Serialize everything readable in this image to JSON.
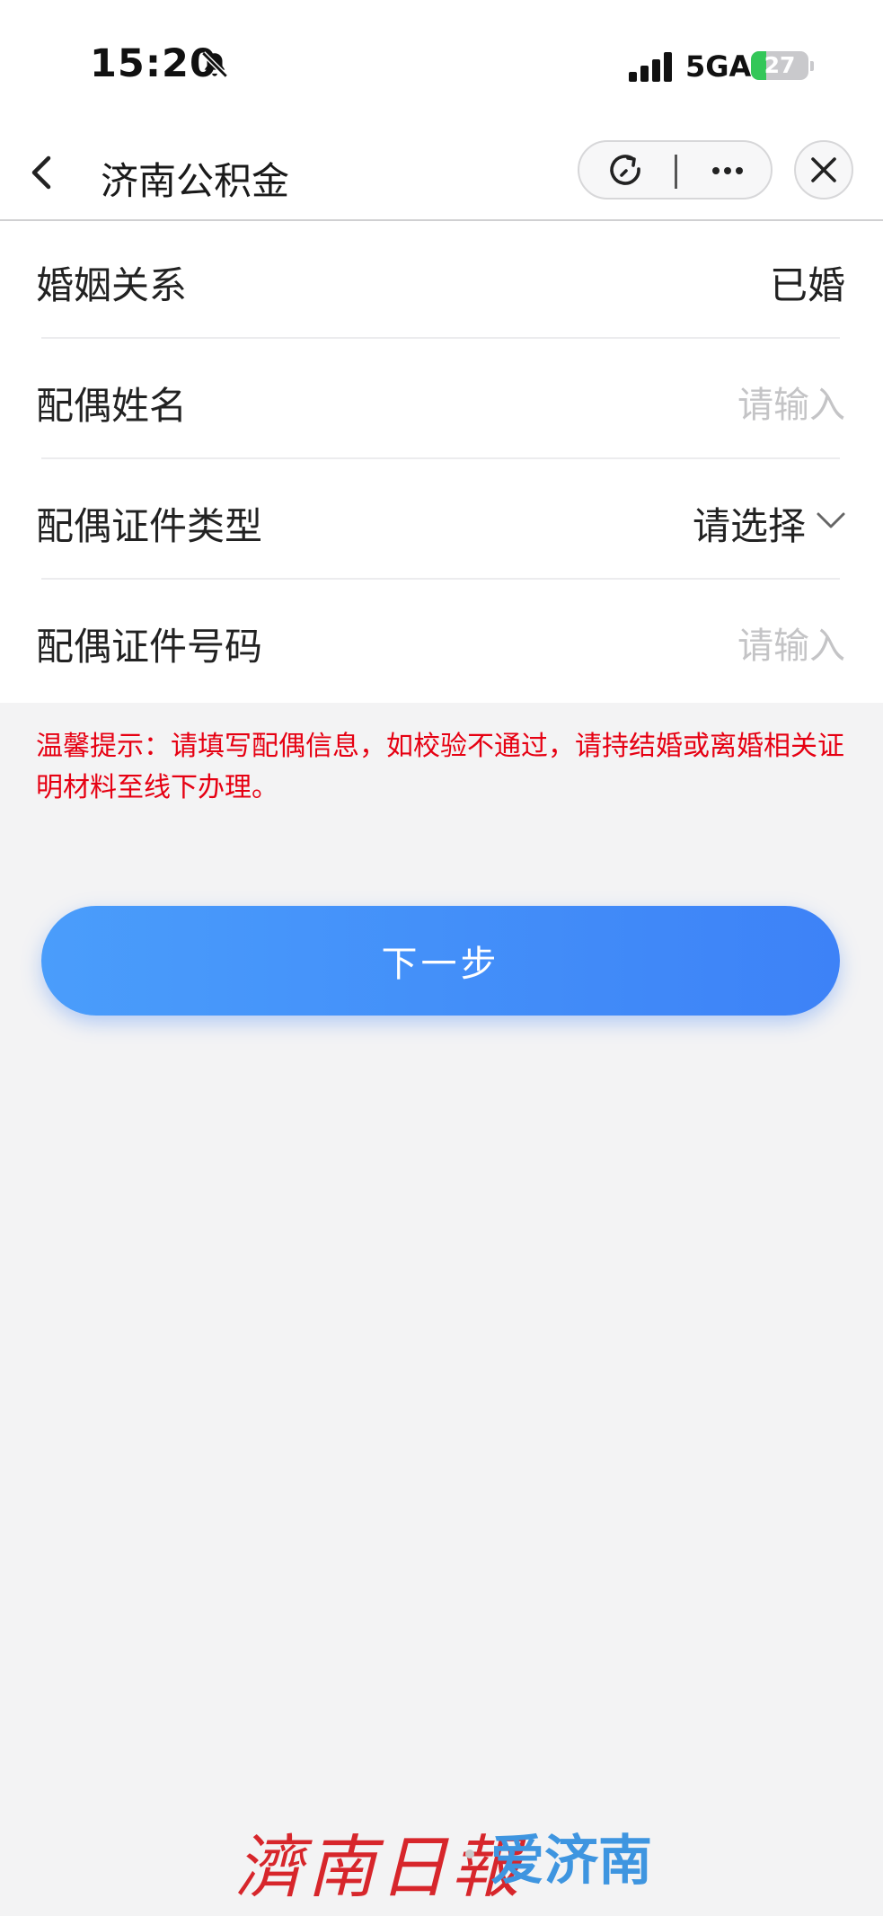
{
  "status_bar": {
    "time": "15:20",
    "network": "5GA",
    "battery": "27",
    "battery_level": 0.27,
    "icons": [
      "bell-slash-icon",
      "signal-icon",
      "battery-charging-icon"
    ]
  },
  "nav": {
    "title": "济南公积金",
    "icons": [
      "back-arrow-icon",
      "refresh-icon",
      "more-dots-icon",
      "close-icon"
    ]
  },
  "form": {
    "marital_status": {
      "label": "婚姻关系",
      "value": "已婚"
    },
    "spouse_name": {
      "label": "配偶姓名",
      "placeholder": "请输入"
    },
    "spouse_id_type": {
      "label": "配偶证件类型",
      "value": "请选择"
    },
    "spouse_id_number": {
      "label": "配偶证件号码",
      "placeholder": "请输入"
    }
  },
  "tip": "温馨提示：请填写配偶信息，如校验不通过，请持结婚或离婚相关证明材料至线下办理。",
  "next_button": "下一步",
  "watermark": {
    "left": "濟南日報",
    "right": "爱济南"
  },
  "colors": {
    "primary": "#3d82f7",
    "tip_red": "#e60012",
    "background": "#f3f3f4",
    "placeholder": "#c4c4c6"
  }
}
